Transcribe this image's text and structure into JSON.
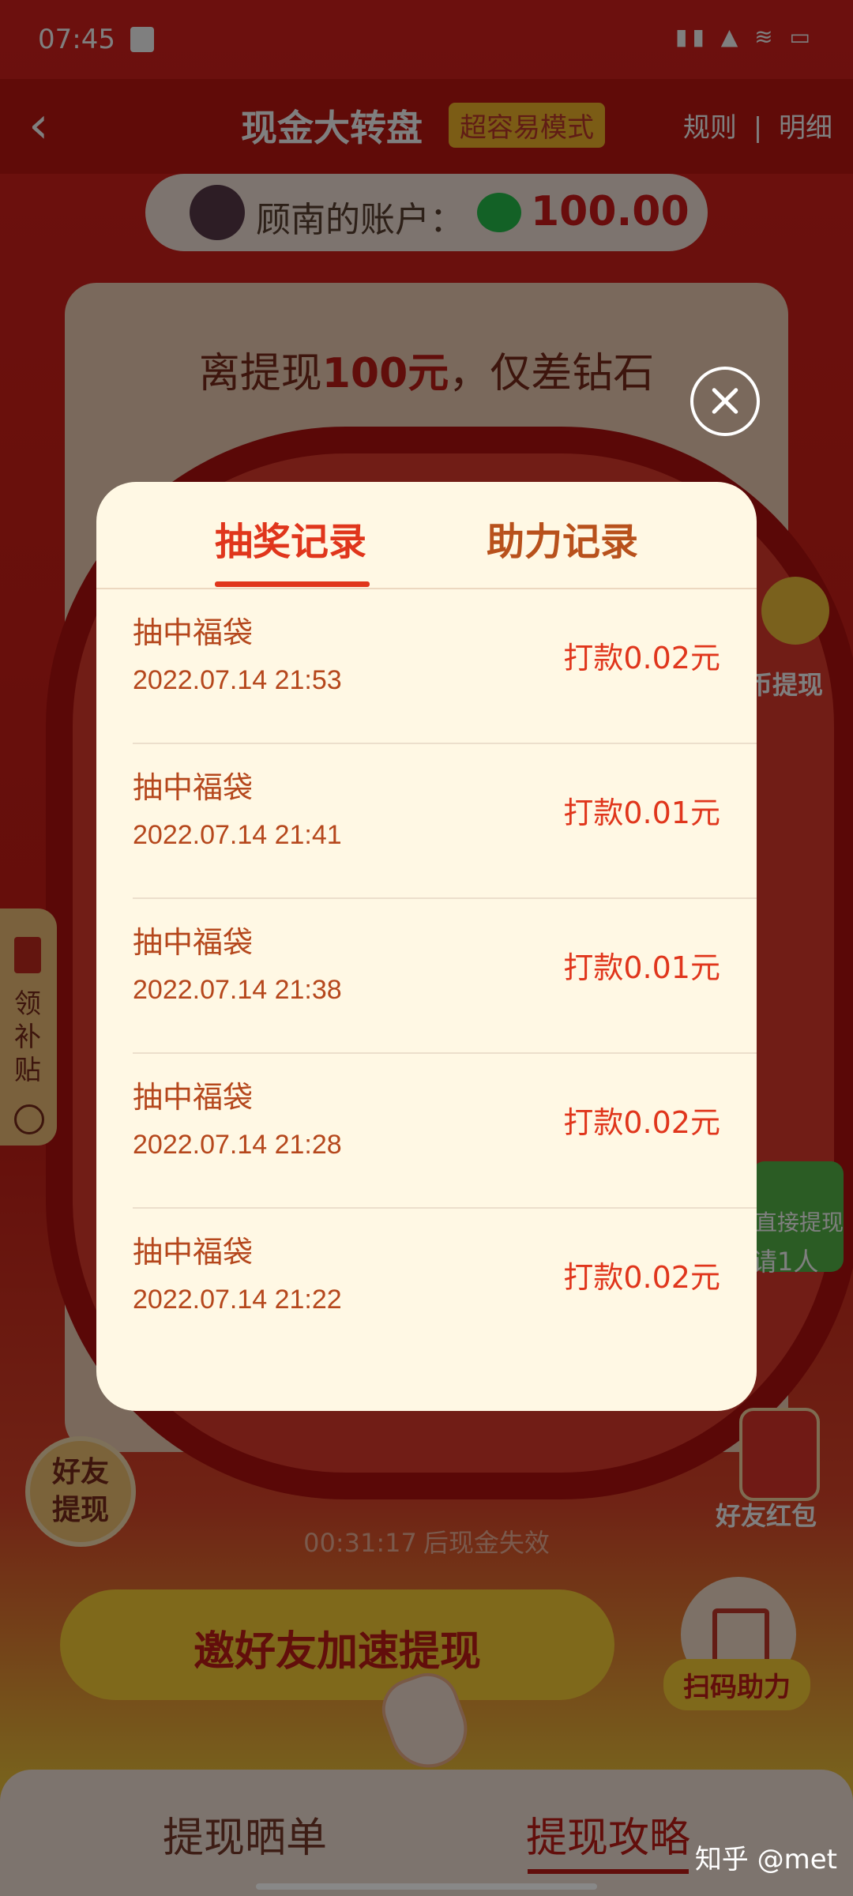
{
  "status_bar": {
    "time": "07:45",
    "system_icons": "▮▮ ▲ ≋ ▭"
  },
  "nav": {
    "back_icon": "‹",
    "title": "现金大转盘",
    "mode_badge": "超容易模式",
    "rules": "规则",
    "separator": "|",
    "details": "明细"
  },
  "account": {
    "label": "顾南的账户：",
    "amount": "100.00"
  },
  "progress_text": {
    "prefix": "离提现",
    "highlight": "100元",
    "suffix": "，仅差钻石"
  },
  "side_left": {
    "label": "领补贴"
  },
  "coin_button": {
    "label": "币提现"
  },
  "withdraw_button": {
    "label": "直接提现",
    "invite": "请1人"
  },
  "friend_help": {
    "label": "好友提现"
  },
  "friend_redpacket": {
    "label": "好友红包"
  },
  "countdown": {
    "time": "00:31:17",
    "suffix": "后现金失效"
  },
  "invite_button": {
    "label": "邀好友加速提现"
  },
  "scan_button": {
    "label": "扫码助力"
  },
  "bottom_tabs": {
    "tab1": "提现晒单",
    "tab2": "提现攻略"
  },
  "watermark": "知乎 @met",
  "modal": {
    "tabs": {
      "lottery": "抽奖记录",
      "assist": "助力记录"
    },
    "records": [
      {
        "title": "抽中福袋",
        "time": "2022.07.14 21:53",
        "amount": "打款0.02元"
      },
      {
        "title": "抽中福袋",
        "time": "2022.07.14 21:41",
        "amount": "打款0.01元"
      },
      {
        "title": "抽中福袋",
        "time": "2022.07.14 21:38",
        "amount": "打款0.01元"
      },
      {
        "title": "抽中福袋",
        "time": "2022.07.14 21:28",
        "amount": "打款0.02元"
      },
      {
        "title": "抽中福袋",
        "time": "2022.07.14 21:22",
        "amount": "打款0.02元"
      }
    ]
  },
  "colors": {
    "primary_red": "#e0361c",
    "record_text": "#b5471c",
    "modal_bg": "#fff8e4"
  }
}
